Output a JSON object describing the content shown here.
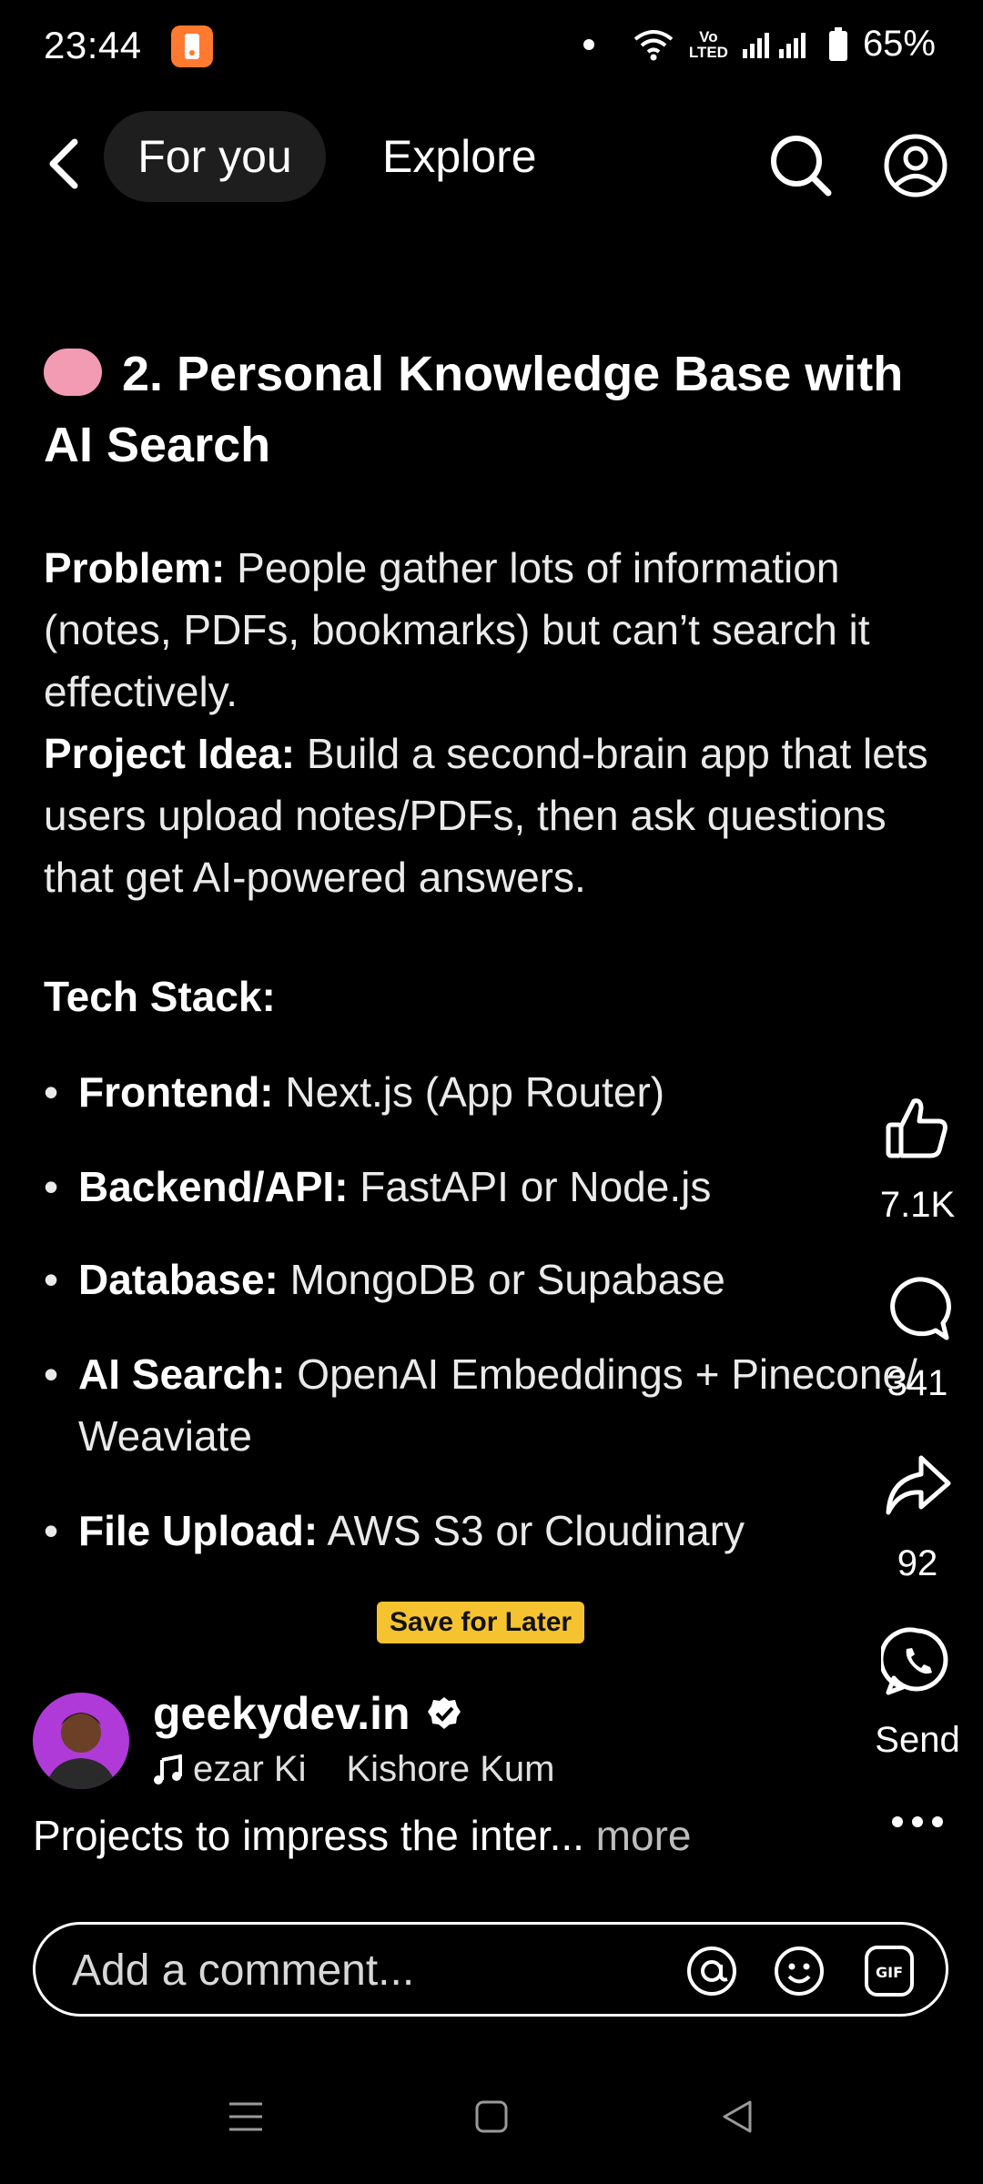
{
  "status": {
    "time": "23:44",
    "volte_top": "Vo",
    "volte_bottom": "LTED",
    "battery": "65%"
  },
  "nav": {
    "tabs": [
      {
        "label": "For you"
      },
      {
        "label": "Explore"
      }
    ]
  },
  "post": {
    "title": "2. Personal Knowledge Base with AI Search",
    "problem_label": "Problem:",
    "problem_text": " People gather lots of information (notes, PDFs, bookmarks) but can’t search it effectively.",
    "idea_label": "Project Idea:",
    "idea_text": " Build a second-brain app that lets users upload notes/PDFs, then ask questions that get AI-powered answers.",
    "tech_heading": "Tech Stack:",
    "tech": [
      {
        "label": "Frontend:",
        "value": " Next.js (App Router)"
      },
      {
        "label": "Backend/API:",
        "value": " FastAPI or Node.js"
      },
      {
        "label": "Database:",
        "value": " MongoDB or Supabase"
      },
      {
        "label": "AI Search:",
        "value": " OpenAI Embeddings + Pinecone/ Weaviate"
      },
      {
        "label": "File Upload:",
        "value": " AWS S3 or Cloudinary"
      }
    ],
    "save_badge": "Save for Later",
    "bullet_char": "•"
  },
  "rail": {
    "likes": "7.1K",
    "comments": "341",
    "shares": "92",
    "send_label": "Send"
  },
  "author": {
    "name": "geekydev.in",
    "music_a": "ezar Ki",
    "music_b": "Kishore Kum"
  },
  "caption": {
    "text": "Projects to impress the inter...",
    "more": " more"
  },
  "comment": {
    "placeholder": "Add a comment..."
  }
}
